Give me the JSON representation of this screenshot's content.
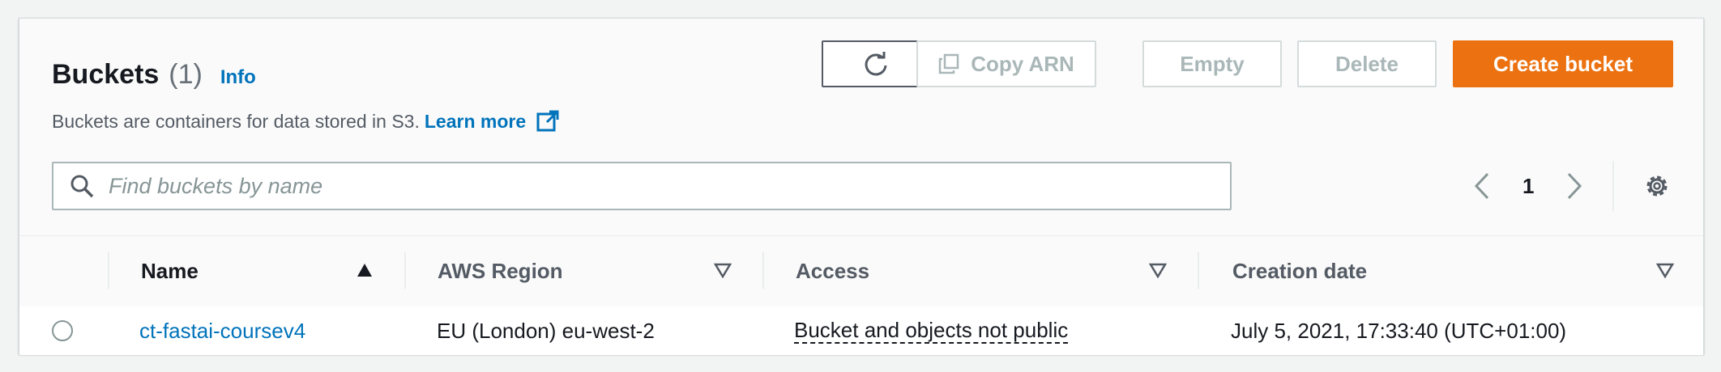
{
  "header": {
    "title": "Buckets",
    "count": "(1)",
    "info": "Info",
    "description": "Buckets are containers for data stored in S3.",
    "learn_more": "Learn more"
  },
  "actions": {
    "copy_arn": "Copy ARN",
    "empty": "Empty",
    "delete": "Delete",
    "create_bucket": "Create bucket"
  },
  "search": {
    "placeholder": "Find buckets by name",
    "value": ""
  },
  "pagination": {
    "current_page": "1"
  },
  "table": {
    "columns": [
      "Name",
      "AWS Region",
      "Access",
      "Creation date"
    ],
    "rows": [
      {
        "name": "ct-fastai-coursev4",
        "region": "EU (London) eu-west-2",
        "access": "Bucket and objects not public",
        "created": "July 5, 2021, 17:33:40 (UTC+01:00)"
      }
    ]
  },
  "colors": {
    "primary": "#ec7211",
    "link": "#0073bb",
    "text": "#16191f",
    "muted": "#545b64"
  },
  "icons": [
    "refresh-icon",
    "copy-icon",
    "external-link-icon",
    "search-icon",
    "chevron-left-icon",
    "chevron-right-icon",
    "settings-gear-icon",
    "sort-ascending-icon",
    "filter-triangle-icon"
  ]
}
